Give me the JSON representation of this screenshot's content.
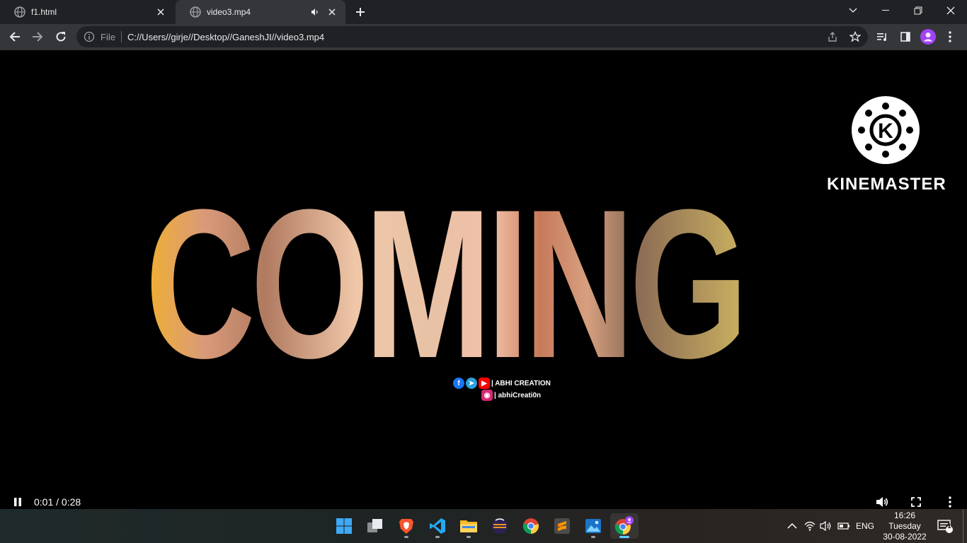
{
  "browser": {
    "tabs": [
      {
        "title": "f1.html",
        "active": false
      },
      {
        "title": "video3.mp4",
        "active": true
      }
    ],
    "address": {
      "scheme_label": "File",
      "url": "C://Users//girje//Desktop//GaneshJI//video3.mp4"
    }
  },
  "video": {
    "overlay_text": "COMING",
    "watermark": "KINEMASTER",
    "credit_line1": "| ABHI CREATION",
    "credit_line2": "| abhiCreati0n",
    "time_display": "0:01 / 0:28",
    "progress_fraction": 0.072
  },
  "taskbar": {
    "language": "ENG",
    "time": "16:26",
    "day": "Tuesday",
    "date": "30-08-2022",
    "notification_count": "1"
  }
}
